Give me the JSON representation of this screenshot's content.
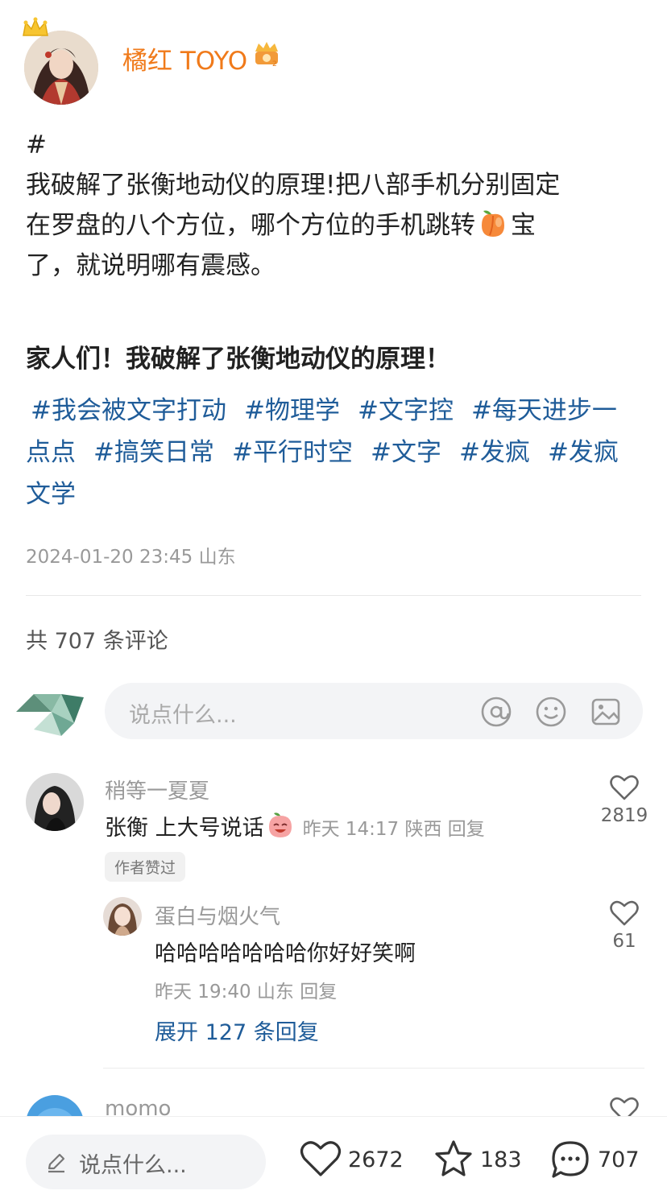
{
  "author": {
    "name": "橘红 TOYO",
    "avatar": "author-avatar",
    "crown_icon": "crown-icon",
    "vip_icon": "vip-badge-icon"
  },
  "post": {
    "lines": [
      "#",
      "我破解了张衡地动仪的原理!把八部手机分别固定",
      "在罗盘的八个方位，哪个方位的手机跳转",
      "宝",
      "了，就说明哪有震感。"
    ],
    "emoji": "peach-emoji",
    "title": "家人们！我破解了张衡地动仪的原理！",
    "tags_line1": [
      "#我会被文字打动",
      "#物理学",
      "#文字控",
      "#每天进步一"
    ],
    "tags_line2": [
      "点点",
      "#搞笑日常",
      "#平行时空",
      "#文字",
      "#发疯",
      "#发疯"
    ],
    "tags_line3": [
      "文学"
    ],
    "meta": "2024-01-20 23:45 山东"
  },
  "comments_header": {
    "count_text": "共 707 条评论"
  },
  "composer": {
    "placeholder": "说点什么...",
    "icons": [
      "at-icon",
      "emoji-icon",
      "image-icon"
    ]
  },
  "comments": [
    {
      "name": "稍等一夏夏",
      "text": "张衡 上大号说话",
      "sticker": "laughing-peach-sticker",
      "meta": "昨天 14:17 陕西 回复",
      "likes": "2819",
      "badge": "作者赞过",
      "reply": {
        "name": "蛋白与烟火气",
        "text": "哈哈哈哈哈哈哈你好好笑啊",
        "meta": "昨天 19:40 山东 回复",
        "likes": "61"
      },
      "expand": "展开 127 条回复"
    },
    {
      "name": "momo"
    }
  ],
  "bottom_bar": {
    "placeholder": "说点什么...",
    "likes": "2672",
    "stars": "183",
    "comments": "707"
  },
  "colors": {
    "author": "#f07a1a",
    "link": "#1f5c99",
    "muted": "#999999"
  }
}
